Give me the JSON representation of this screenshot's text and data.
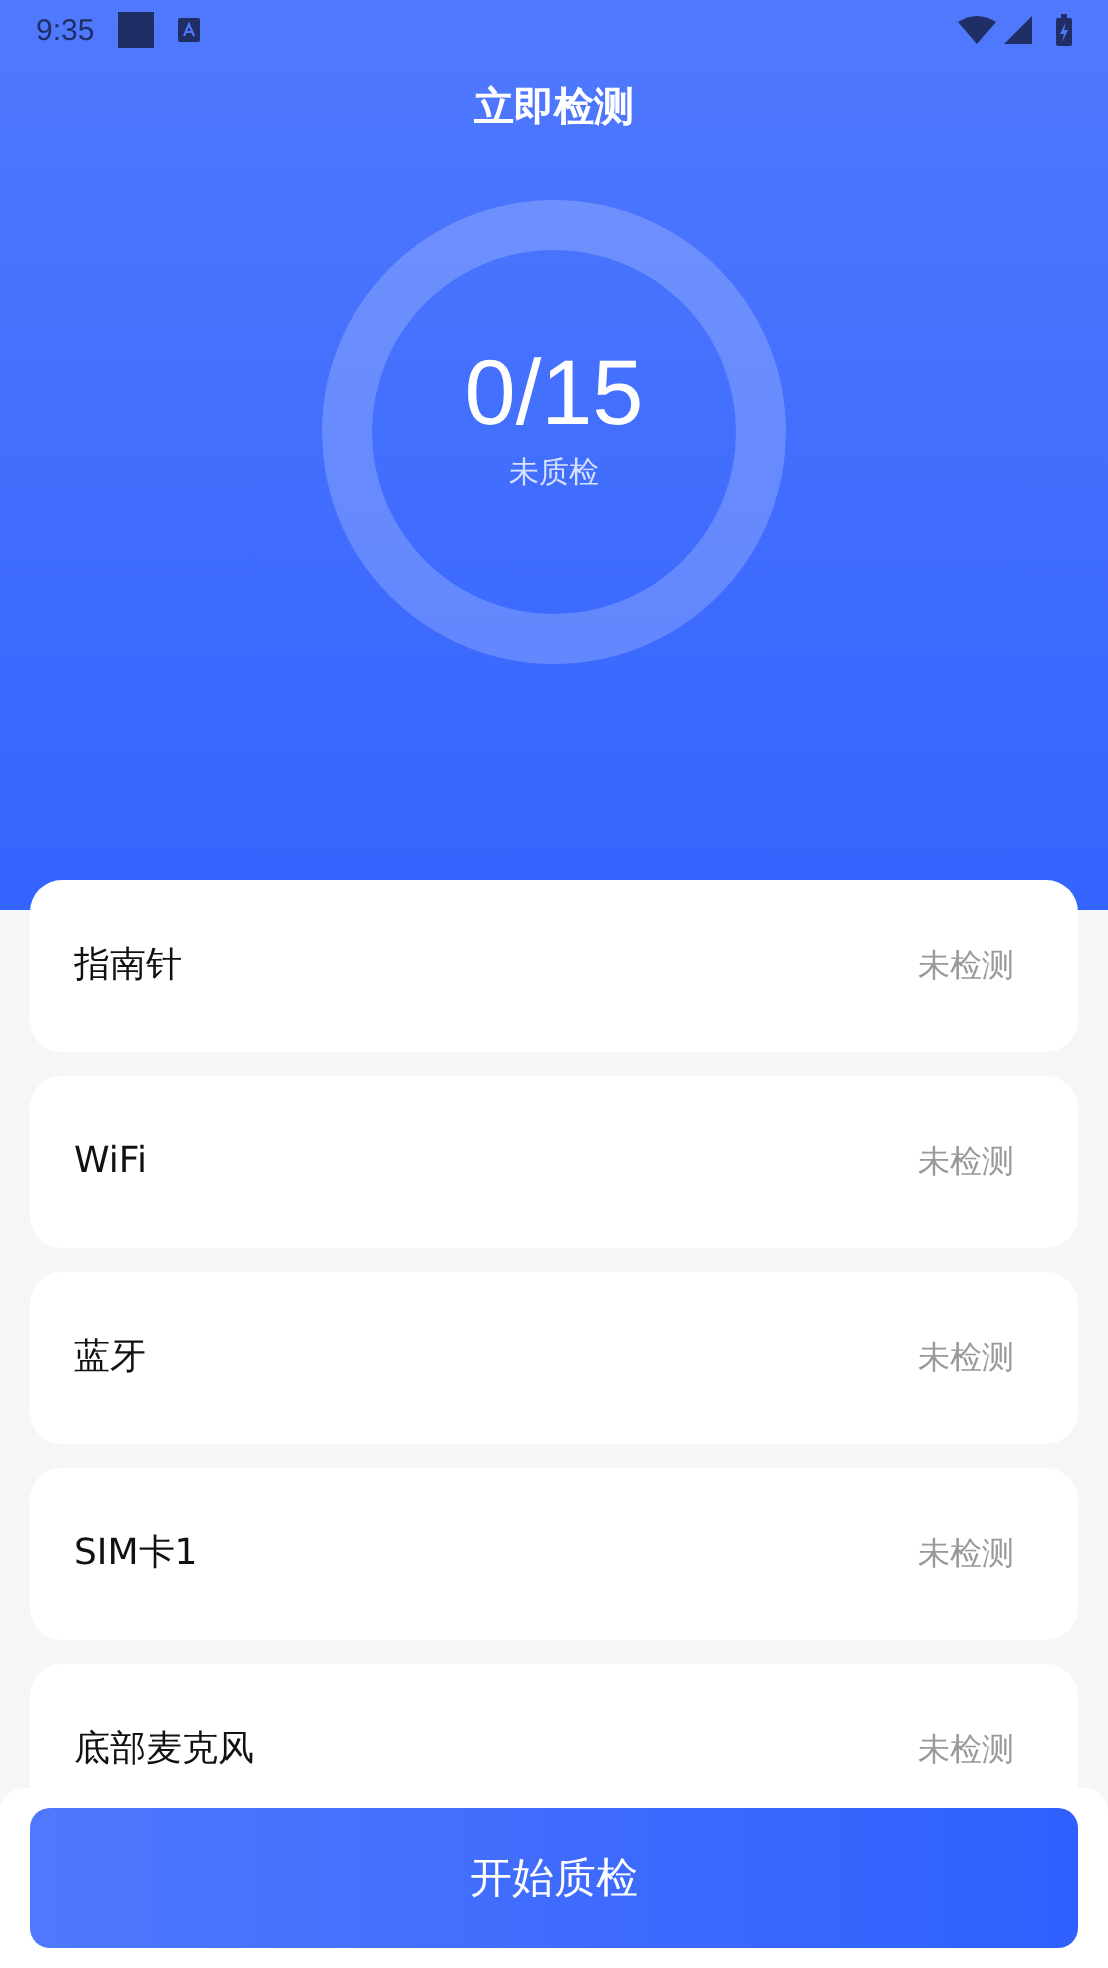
{
  "status_bar": {
    "time": "9:35"
  },
  "title": "立即检测",
  "summary": {
    "count": "0/15",
    "caption": "未质检"
  },
  "items": [
    {
      "name": "指南针",
      "status": "未检测"
    },
    {
      "name": "WiFi",
      "status": "未检测"
    },
    {
      "name": "蓝牙",
      "status": "未检测"
    },
    {
      "name": "SIM卡1",
      "status": "未检测"
    },
    {
      "name": "底部麦克风",
      "status": "未检测"
    }
  ],
  "start_button": "开始质检"
}
